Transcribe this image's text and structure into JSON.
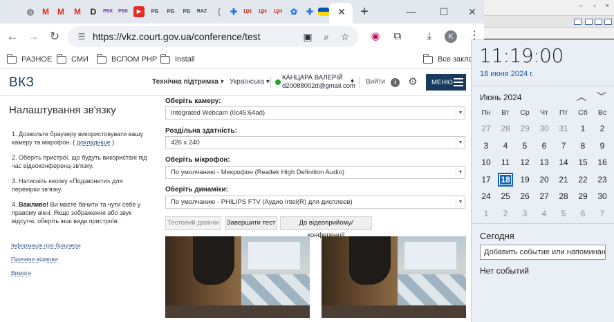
{
  "browser": {
    "tab_icons": [
      {
        "icon": "globe-icon",
        "glyph": "◍",
        "color": "#7a7f86"
      },
      {
        "icon": "gmail-icon",
        "glyph": "M",
        "color": "#d93025"
      },
      {
        "icon": "gmail-icon",
        "glyph": "M",
        "color": "#d93025"
      },
      {
        "icon": "gmail-icon",
        "glyph": "M",
        "color": "#d93025"
      },
      {
        "icon": "site-d-icon",
        "glyph": "D",
        "color": "#222222"
      },
      {
        "icon": "rbk-icon",
        "glyph": "РБК",
        "color": "#6b3fa0"
      },
      {
        "icon": "rbk-icon",
        "glyph": "РБК",
        "color": "#6b3fa0"
      },
      {
        "icon": "youtube-icon",
        "glyph": "▶",
        "color": "#e52d27"
      },
      {
        "icon": "rb-icon",
        "glyph": "РБ",
        "color": "#555555"
      },
      {
        "icon": "rb-icon",
        "glyph": "РБ",
        "color": "#555555"
      },
      {
        "icon": "rb-icon",
        "glyph": "РБ",
        "color": "#555555"
      },
      {
        "icon": "raz-icon",
        "glyph": "RAZ",
        "color": "#444444"
      },
      {
        "icon": "loading-icon",
        "glyph": "(",
        "color": "#8a8f95"
      },
      {
        "icon": "puzzle-icon",
        "glyph": "✚",
        "color": "#1a73e8"
      },
      {
        "icon": "cn-icon",
        "glyph": "ЦН",
        "color": "#c0392b"
      },
      {
        "icon": "cn-icon",
        "glyph": "ЦН",
        "color": "#c0392b"
      },
      {
        "icon": "cn-icon",
        "glyph": "ЦН",
        "color": "#c0392b"
      },
      {
        "icon": "gear-icon",
        "glyph": "✿",
        "color": "#1a73e8"
      },
      {
        "icon": "puzzle-icon",
        "glyph": "✚",
        "color": "#1a73e8"
      },
      {
        "icon": "ukraine-flag-icon",
        "glyph": "",
        "color": "#0057b7"
      }
    ],
    "url": "https://vkz.court.gov.ua/conference/test",
    "profile_initial": "K",
    "bookmarks": [
      "РАЗНОЕ",
      "СМИ",
      "ВСПОМ PHP",
      "Install",
      "Все заклад"
    ]
  },
  "site": {
    "logo": "ВКЗ",
    "tech_support": "Технічна підтримка",
    "language": "Українська",
    "user_name": "КАНЦАРА ВАЛЕРІЙ",
    "user_email": "d20088002d@gmail.com",
    "exit": "Вийти",
    "menu": "МЕНЮ"
  },
  "left": {
    "title": "Налаштування зв'язку",
    "step1_text": "1. Дозвольте браузеру використовувати вашу камеру та мікрофон. ( ",
    "step1_link": "докладніше",
    "step1_end": " )",
    "step2": "2. Оберіть пристрої, що будуть використані під час відеоконференц-зв'язку.",
    "step3": "3. Натисніть кнопку «Подзвонити» для перевірки зв'язку.",
    "important_label": "Важливо!",
    "important_text": " Ви маєте бачити та чути себе у правому вікні. Якщо зображення або звук відсутні, оберіть інші види пристроїв.",
    "links": [
      "Інформація про браузери",
      "Причини відмови",
      "Вимоги"
    ]
  },
  "form": {
    "camera_label": "Оберіть камеру:",
    "camera_value": "Integrated Webcam (0c45:64ad)",
    "resolution_label": "Роздільна здатність:",
    "resolution_value": "426 x 240",
    "mic_label": "Оберіть мікрофон:",
    "mic_value": "По умолчанию - Микрофон (Realtek High Definition Audio)",
    "speaker_label": "Оберіть динаміки:",
    "speaker_value": "По умолчанию - PHILIPS FTV (Аудио Intel(R) для дисплеев)",
    "btn_test_call": "Тестовий дзвінок",
    "btn_finish": "Завершити тест",
    "btn_to_reception": "До відеоприйому/конференції"
  },
  "calendar": {
    "time": "11:19:00",
    "date": "18 июня 2024 г.",
    "month": "Июнь 2024",
    "weekdays": [
      "Пн",
      "Вт",
      "Ср",
      "Чт",
      "Пт",
      "Сб",
      "Вс"
    ],
    "weeks": [
      [
        "27",
        "28",
        "29",
        "30",
        "31",
        "1",
        "2"
      ],
      [
        "3",
        "4",
        "5",
        "6",
        "7",
        "8",
        "9"
      ],
      [
        "10",
        "11",
        "12",
        "13",
        "14",
        "15",
        "16"
      ],
      [
        "17",
        "18",
        "19",
        "20",
        "21",
        "22",
        "23"
      ],
      [
        "24",
        "25",
        "26",
        "27",
        "28",
        "29",
        "30"
      ],
      [
        "1",
        "2",
        "3",
        "4",
        "5",
        "6",
        "7"
      ]
    ],
    "selected_day": "18",
    "today_label": "Сегодня",
    "event_placeholder": "Добавить событие или напоминание",
    "no_events": "Нет событий"
  },
  "colors": {
    "accent": "#1464b8",
    "menu_bg": "#173a5e",
    "online": "#2aa12a"
  }
}
